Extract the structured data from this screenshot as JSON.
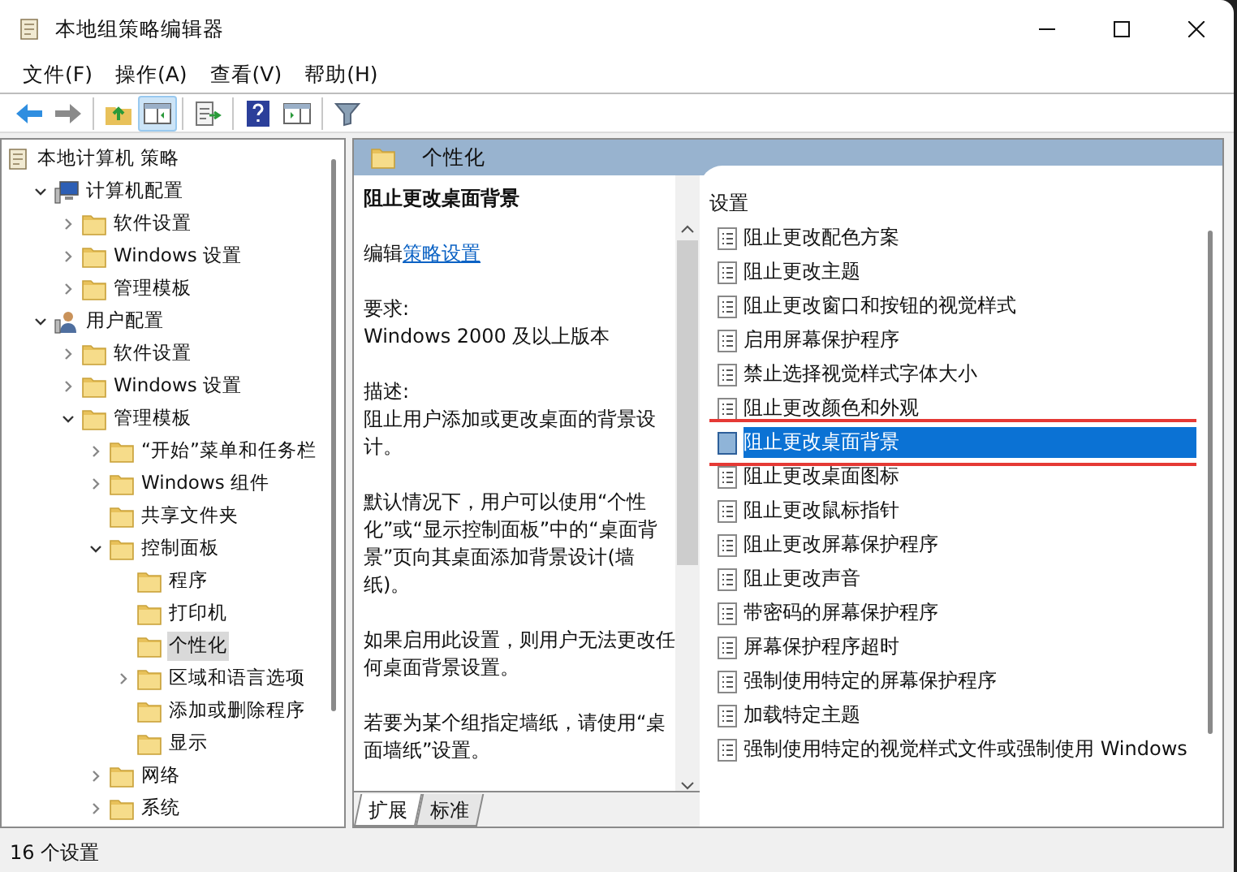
{
  "window": {
    "title": "本地组策略编辑器"
  },
  "menu": [
    "文件(F)",
    "操作(A)",
    "查看(V)",
    "帮助(H)"
  ],
  "toolbar": [
    {
      "kind": "back",
      "selected": false
    },
    {
      "kind": "forward",
      "selected": false
    },
    {
      "kind": "sep"
    },
    {
      "kind": "up",
      "selected": false
    },
    {
      "kind": "tree",
      "selected": true
    },
    {
      "kind": "sep"
    },
    {
      "kind": "export",
      "selected": false
    },
    {
      "kind": "sep"
    },
    {
      "kind": "help",
      "selected": false
    },
    {
      "kind": "pane",
      "selected": false
    },
    {
      "kind": "sep"
    },
    {
      "kind": "filter",
      "selected": false
    }
  ],
  "tree": [
    {
      "label": "本地计算机 策略",
      "kind": "policy",
      "selected": false,
      "children": [
        {
          "label": "计算机配置",
          "kind": "computer",
          "has_children": true,
          "expanded": true,
          "selected": false,
          "children": [
            {
              "label": "软件设置",
              "kind": "folder",
              "has_children": true,
              "expanded": false,
              "selected": false
            },
            {
              "label": "Windows 设置",
              "kind": "folder",
              "has_children": true,
              "expanded": false,
              "selected": false
            },
            {
              "label": "管理模板",
              "kind": "folder",
              "has_children": true,
              "expanded": false,
              "selected": false
            }
          ]
        },
        {
          "label": "用户配置",
          "kind": "user",
          "has_children": true,
          "expanded": true,
          "selected": false,
          "children": [
            {
              "label": "软件设置",
              "kind": "folder",
              "has_children": true,
              "expanded": false,
              "selected": false
            },
            {
              "label": "Windows 设置",
              "kind": "folder",
              "has_children": true,
              "expanded": false,
              "selected": false
            },
            {
              "label": "管理模板",
              "kind": "folder",
              "has_children": true,
              "expanded": true,
              "selected": false,
              "children": [
                {
                  "label": "“开始”菜单和任务栏",
                  "kind": "folder",
                  "has_children": true,
                  "expanded": false,
                  "selected": false
                },
                {
                  "label": "Windows 组件",
                  "kind": "folder",
                  "has_children": true,
                  "expanded": false,
                  "selected": false
                },
                {
                  "label": "共享文件夹",
                  "kind": "folder",
                  "has_children": false,
                  "selected": false
                },
                {
                  "label": "控制面板",
                  "kind": "folder",
                  "has_children": true,
                  "expanded": true,
                  "selected": false,
                  "children": [
                    {
                      "label": "程序",
                      "kind": "folder",
                      "has_children": false,
                      "selected": false
                    },
                    {
                      "label": "打印机",
                      "kind": "folder",
                      "has_children": false,
                      "selected": false
                    },
                    {
                      "label": "个性化",
                      "kind": "folder",
                      "has_children": false,
                      "selected": true
                    },
                    {
                      "label": "区域和语言选项",
                      "kind": "folder",
                      "has_children": true,
                      "expanded": false,
                      "selected": false
                    },
                    {
                      "label": "添加或删除程序",
                      "kind": "folder",
                      "has_children": false,
                      "selected": false
                    },
                    {
                      "label": "显示",
                      "kind": "folder",
                      "has_children": false,
                      "selected": false
                    }
                  ]
                },
                {
                  "label": "网络",
                  "kind": "folder",
                  "has_children": true,
                  "expanded": false,
                  "selected": false
                },
                {
                  "label": "系统",
                  "kind": "folder",
                  "has_children": true,
                  "expanded": false,
                  "selected": false
                }
              ]
            }
          ]
        }
      ]
    }
  ],
  "header": {
    "title": "个性化"
  },
  "description": {
    "title": "阻止更改桌面背景",
    "edit_prefix": "编辑",
    "edit_link": "策略设置",
    "requirements_label": "要求:",
    "requirements": "Windows 2000 及以上版本",
    "description_label": "描述:",
    "paragraphs": [
      "阻止用户添加或更改桌面的背景设计。",
      "默认情况下，用户可以使用“个性化”或“显示控制面板”中的“桌面背景”页向其桌面添加背景设计(墙纸)。",
      "如果启用此设置，则用户无法更改任何桌面背景设置。",
      "若要为某个组指定墙纸，请使用“桌面墙纸”设置。"
    ]
  },
  "settings": {
    "column": "设置",
    "items": [
      {
        "label": "阻止更改配色方案",
        "selected": false,
        "annotated": false
      },
      {
        "label": "阻止更改主题",
        "selected": false,
        "annotated": false
      },
      {
        "label": "阻止更改窗口和按钮的视觉样式",
        "selected": false,
        "annotated": false
      },
      {
        "label": "启用屏幕保护程序",
        "selected": false,
        "annotated": false
      },
      {
        "label": "禁止选择视觉样式字体大小",
        "selected": false,
        "annotated": false
      },
      {
        "label": "阻止更改颜色和外观",
        "selected": false,
        "annotated": false
      },
      {
        "label": "阻止更改桌面背景",
        "selected": true,
        "annotated": true
      },
      {
        "label": "阻止更改桌面图标",
        "selected": false,
        "annotated": false
      },
      {
        "label": "阻止更改鼠标指针",
        "selected": false,
        "annotated": false
      },
      {
        "label": "阻止更改屏幕保护程序",
        "selected": false,
        "annotated": false
      },
      {
        "label": "阻止更改声音",
        "selected": false,
        "annotated": false
      },
      {
        "label": "带密码的屏幕保护程序",
        "selected": false,
        "annotated": false
      },
      {
        "label": "屏幕保护程序超时",
        "selected": false,
        "annotated": false
      },
      {
        "label": "强制使用特定的屏幕保护程序",
        "selected": false,
        "annotated": false
      },
      {
        "label": "加载特定主题",
        "selected": false,
        "annotated": false
      },
      {
        "label": "强制使用特定的视觉样式文件或强制使用 Windows",
        "selected": false,
        "annotated": false
      }
    ]
  },
  "tabs": [
    {
      "label": "扩展",
      "selected": true
    },
    {
      "label": "标准",
      "selected": false
    }
  ],
  "status_bar": "16 个设置"
}
